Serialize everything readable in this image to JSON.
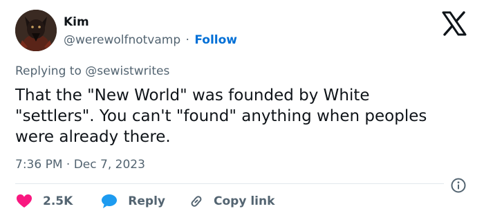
{
  "author": {
    "name": "Kim",
    "handle": "@werewolfnotvamp",
    "separator": "·",
    "follow_label": "Follow"
  },
  "reply_context": {
    "text": "Replying to @sewistwrites"
  },
  "tweet": {
    "text": "That the \"New World\" was founded by White \"settlers\". You can't \"found\" anything when peoples were already there.",
    "timestamp": "7:36 PM · Dec 7, 2023"
  },
  "actions": {
    "like_count": "2.5K",
    "reply_label": "Reply",
    "copy_link_label": "Copy link"
  },
  "colors": {
    "text_primary": "#0f1419",
    "text_secondary": "#536471",
    "link_blue": "#006fd6",
    "like_red": "#f91880",
    "reply_blue": "#1d9bf0"
  },
  "icons": {
    "brand": "x-logo-icon",
    "info": "info-icon",
    "like": "heart-icon",
    "reply": "speech-bubble-icon",
    "copy_link": "link-icon"
  }
}
